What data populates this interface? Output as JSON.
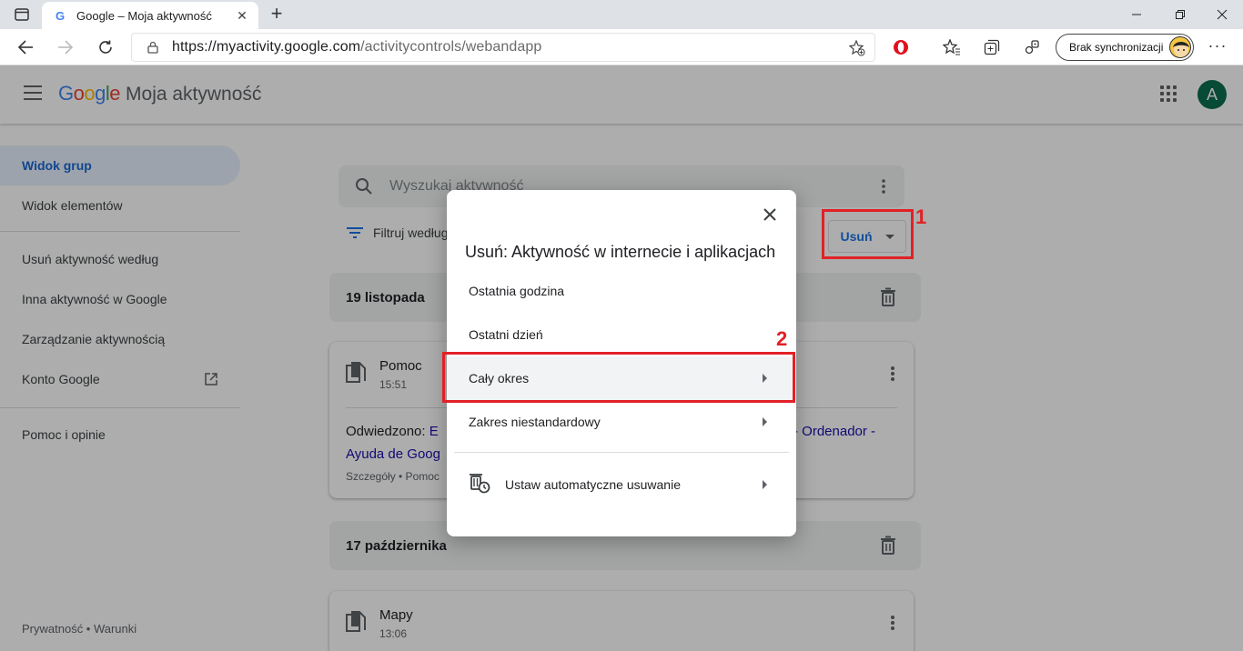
{
  "browser": {
    "tab_title": "Google – Moja aktywność",
    "tab_favicon": "G",
    "url_host": "https://myactivity.google.com",
    "url_path": "/activitycontrols/webandapp",
    "sync_label": "Brak synchronizacji"
  },
  "app": {
    "brand_google": "Google",
    "brand_product": "Moja aktywność",
    "avatar_letter": "A",
    "sidebar": {
      "items": [
        {
          "label": "Widok grup"
        },
        {
          "label": "Widok elementów"
        },
        {
          "label": "Usuń aktywność według"
        },
        {
          "label": "Inna aktywność w Google"
        },
        {
          "label": "Zarządzanie aktywnością"
        },
        {
          "label": "Konto Google"
        },
        {
          "label": "Pomoc i opinie"
        }
      ],
      "footer": "Prywatność  •  Warunki"
    },
    "search_placeholder": "Wyszukaj aktywność",
    "filter_label": "Filtruj według",
    "delete_button": "Usuń",
    "groups": [
      {
        "date": "19 listopada",
        "card": {
          "title": "Pomoc",
          "time": "15:51",
          "visited_prefix": "Odwiedzono: ",
          "visited_link_start": "E",
          "visited_link_end": "- Ordenador -",
          "visited_line2": "Ayuda de Goog",
          "details": "Szczegóły • Pomoc"
        }
      },
      {
        "date": "17 października",
        "card": {
          "title": "Mapy",
          "time": "13:06"
        }
      }
    ]
  },
  "dialog": {
    "title": "Usuń: Aktywność w internecie i aplikacjach",
    "options": [
      {
        "label": "Ostatnia godzina",
        "has_submenu": false
      },
      {
        "label": "Ostatni dzień",
        "has_submenu": false
      },
      {
        "label": "Cały okres",
        "has_submenu": true
      },
      {
        "label": "Zakres niestandardowy",
        "has_submenu": true
      }
    ],
    "auto_delete": "Ustaw automatyczne usuwanie"
  },
  "annotations": [
    {
      "number": "1"
    },
    {
      "number": "2"
    }
  ],
  "colors": {
    "annotation": "#e12126",
    "accent": "#1a73e8",
    "active_nav": "#e8f0fe"
  }
}
